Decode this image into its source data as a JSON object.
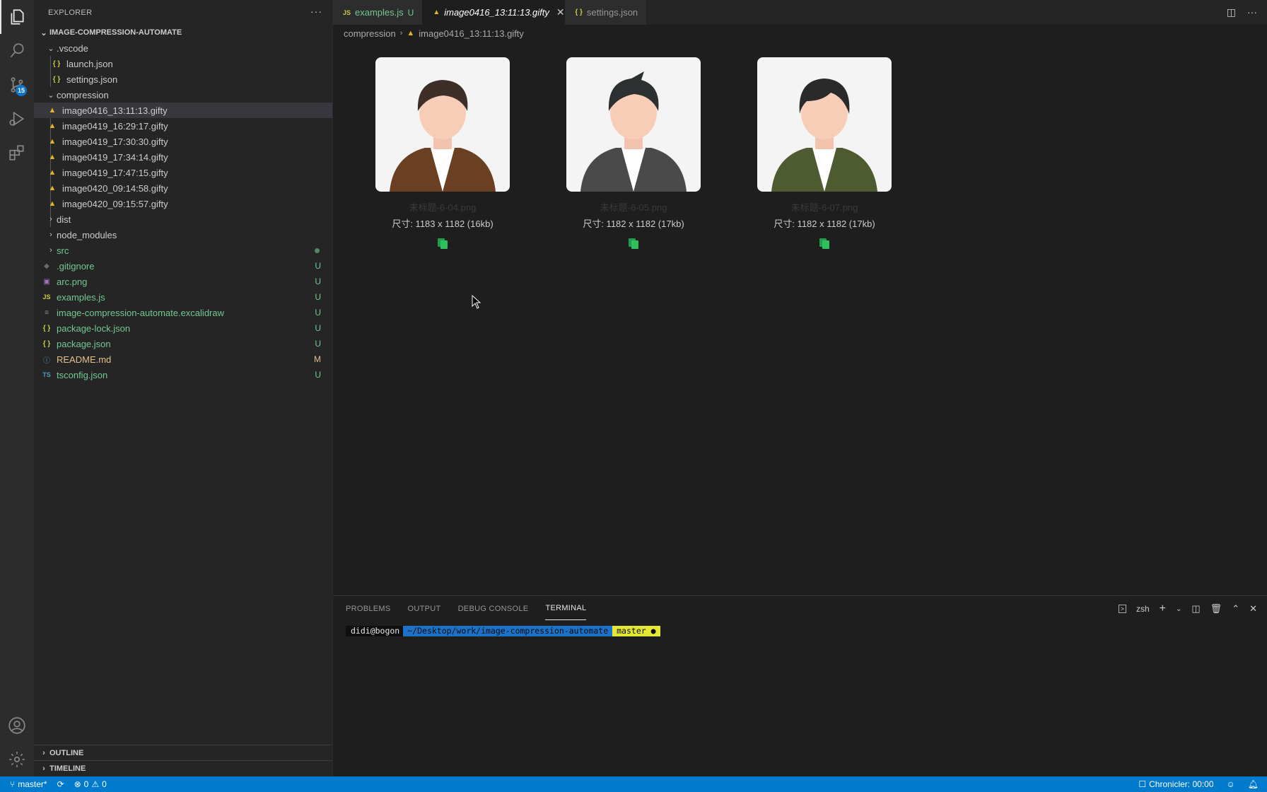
{
  "activity_bar": {
    "scm_badge": "15"
  },
  "sidebar": {
    "title": "EXPLORER",
    "more": "···",
    "root": "IMAGE-COMPRESSION-AUTOMATE",
    "tree": [
      {
        "label": ".vscode",
        "type": "folder",
        "open": true
      },
      {
        "label": "launch.json",
        "type": "json"
      },
      {
        "label": "settings.json",
        "type": "json"
      },
      {
        "label": "compression",
        "type": "folder",
        "open": true
      },
      {
        "label": "image0416_13:11:13.gifty",
        "type": "gifty"
      },
      {
        "label": "image0419_16:29:17.gifty",
        "type": "gifty"
      },
      {
        "label": "image0419_17:30:30.gifty",
        "type": "gifty"
      },
      {
        "label": "image0419_17:34:14.gifty",
        "type": "gifty"
      },
      {
        "label": "image0419_17:47:15.gifty",
        "type": "gifty"
      },
      {
        "label": "image0420_09:14:58.gifty",
        "type": "gifty"
      },
      {
        "label": "image0420_09:15:57.gifty",
        "type": "gifty"
      },
      {
        "label": "dist",
        "type": "folder"
      },
      {
        "label": "node_modules",
        "type": "folder"
      },
      {
        "label": "src",
        "type": "folder"
      },
      {
        "label": ".gitignore",
        "status": "U"
      },
      {
        "label": "arc.png",
        "status": "U"
      },
      {
        "label": "examples.js",
        "status": "U"
      },
      {
        "label": "image-compression-automate.excalidraw",
        "status": "U"
      },
      {
        "label": "package-lock.json",
        "status": "U"
      },
      {
        "label": "package.json",
        "status": "U"
      },
      {
        "label": "README.md",
        "status": "M"
      },
      {
        "label": "tsconfig.json",
        "status": "U"
      }
    ],
    "outline": "OUTLINE",
    "timeline": "TIMELINE"
  },
  "tabs": [
    {
      "label": "examples.js",
      "status": "U",
      "icon": "JS"
    },
    {
      "label": "image0416_13:11:13.gifty",
      "icon": "gifty-icon",
      "close": "✕"
    },
    {
      "label": "settings.json",
      "icon": "{ }"
    }
  ],
  "breadcrumb": {
    "folder": "compression",
    "file": "image0416_13:11:13.gifty"
  },
  "images": [
    {
      "name": "未标题-6-04.png",
      "size": "尺寸: 1183 x 1182 (16kb)",
      "jacket": "#6b3f22",
      "hair": "#3d2f28"
    },
    {
      "name": "未标题-6-05.png",
      "size": "尺寸: 1182 x 1182 (17kb)",
      "jacket": "#4a4a4a",
      "hair": "#2d3030"
    },
    {
      "name": "未标题-6-07.png",
      "size": "尺寸: 1182 x 1182 (17kb)",
      "jacket": "#4e5a30",
      "hair": "#2a2a2a"
    }
  ],
  "panel": {
    "tabs": [
      "PROBLEMS",
      "OUTPUT",
      "DEBUG CONSOLE",
      "TERMINAL"
    ],
    "shell": "zsh",
    "prompt": {
      "user": "didi@bogon",
      "path": "~/Desktop/work/image-compression-automate",
      "branch": "master ●"
    }
  },
  "statusbar": {
    "branch": "master*",
    "errors": "0",
    "warnings": "0",
    "chronicler": "Chronicler: 00:00"
  }
}
